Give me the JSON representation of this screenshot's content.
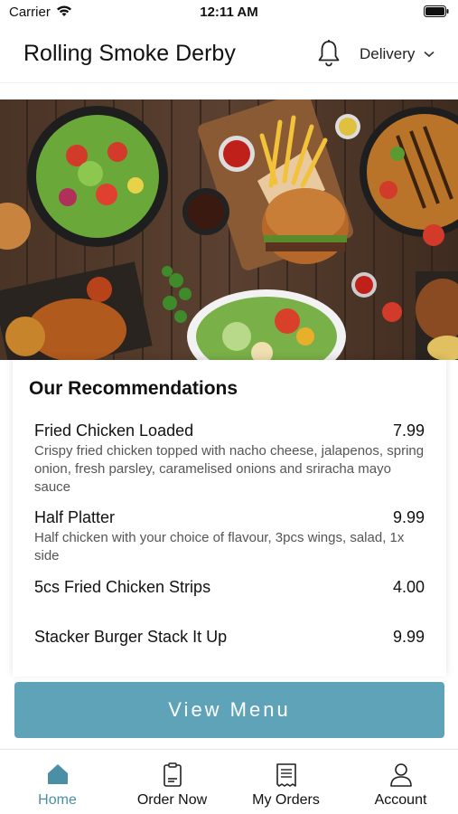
{
  "status_bar": {
    "carrier": "Carrier",
    "time": "12:11 AM"
  },
  "header": {
    "title": "Rolling Smoke Derby",
    "delivery_label": "Delivery"
  },
  "recommendations": {
    "title": "Our Recommendations",
    "items": [
      {
        "name": "Fried Chicken Loaded",
        "price": "7.99",
        "description": "Crispy fried chicken topped with nacho cheese, jalapenos, spring onion, fresh parsley, caramelised onions and sriracha mayo sauce"
      },
      {
        "name": "Half Platter",
        "price": "9.99",
        "description": "Half chicken with your choice of flavour, 3pcs wings, salad, 1x side"
      },
      {
        "name": "5cs Fried Chicken Strips",
        "price": "4.00",
        "description": ""
      },
      {
        "name": "Stacker Burger Stack It Up",
        "price": "9.99",
        "description": ""
      }
    ]
  },
  "view_menu_label": "View Menu",
  "tabs": [
    {
      "label": "Home",
      "icon": "home-icon",
      "active": true
    },
    {
      "label": "Order Now",
      "icon": "order-icon",
      "active": false
    },
    {
      "label": "My Orders",
      "icon": "receipt-icon",
      "active": false
    },
    {
      "label": "Account",
      "icon": "user-icon",
      "active": false
    }
  ],
  "colors": {
    "accent": "#5fa3b8",
    "active_tab": "#4a8fa6"
  }
}
